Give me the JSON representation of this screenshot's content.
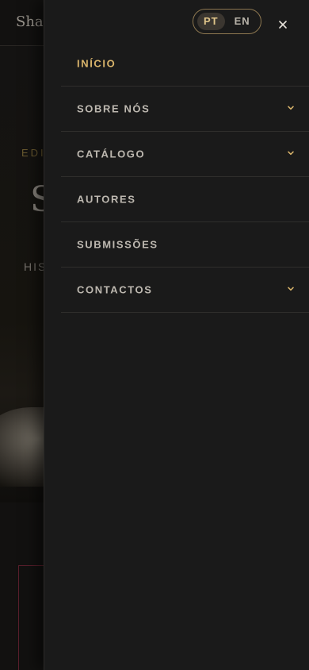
{
  "background": {
    "logo_text": "Shar",
    "eyebrow": "EDI",
    "title_letter": "S",
    "tagline": "HIS"
  },
  "language": {
    "options": [
      "PT",
      "EN"
    ],
    "selected": "PT"
  },
  "menu": {
    "items": [
      {
        "label": "INÍCIO",
        "active": true,
        "has_submenu": false
      },
      {
        "label": "SOBRE NÓS",
        "active": false,
        "has_submenu": true
      },
      {
        "label": "CATÁLOGO",
        "active": false,
        "has_submenu": true
      },
      {
        "label": "AUTORES",
        "active": false,
        "has_submenu": false
      },
      {
        "label": "SUBMISSÕES",
        "active": false,
        "has_submenu": false
      },
      {
        "label": "CONTACTOS",
        "active": false,
        "has_submenu": true
      }
    ]
  },
  "icons": {
    "close": "close-icon",
    "chevron": "chevron-down-icon"
  },
  "colors": {
    "drawer_bg": "#1a1a1a",
    "accent_gold": "#d9b46b",
    "menu_text": "#bdb8b0",
    "divider": "#2f2e2c"
  }
}
